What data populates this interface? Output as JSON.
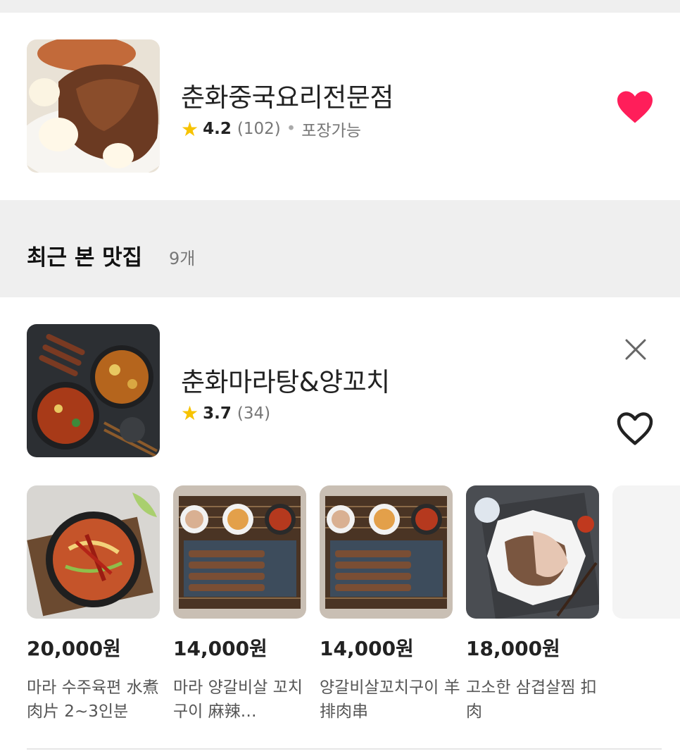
{
  "favorite": {
    "name": "춘화중국요리전문점",
    "rating": "4.2",
    "reviews": "(102)",
    "tag": "포장가능",
    "colors": {
      "heart": "#ff1e5a"
    }
  },
  "recent": {
    "title": "최근 본 맛집",
    "count": "9개",
    "store": {
      "name": "춘화마라탕&양꼬치",
      "rating": "3.7",
      "reviews": "(34)"
    },
    "menus": [
      {
        "price": "20,000원",
        "name": "마라 수주육편 水煮肉片 2~3인분"
      },
      {
        "price": "14,000원",
        "name": "마라 양갈비살 꼬치구이 麻辣…"
      },
      {
        "price": "14,000원",
        "name": "양갈비살꼬치구이 羊排肉串"
      },
      {
        "price": "18,000원",
        "name": "고소한 삼겹살찜 扣肉"
      }
    ]
  },
  "colors": {
    "star": "#f7c300",
    "section_bg": "#efefef"
  },
  "icons": [
    "star-icon",
    "heart-filled-icon",
    "heart-outline-icon",
    "close-icon"
  ]
}
